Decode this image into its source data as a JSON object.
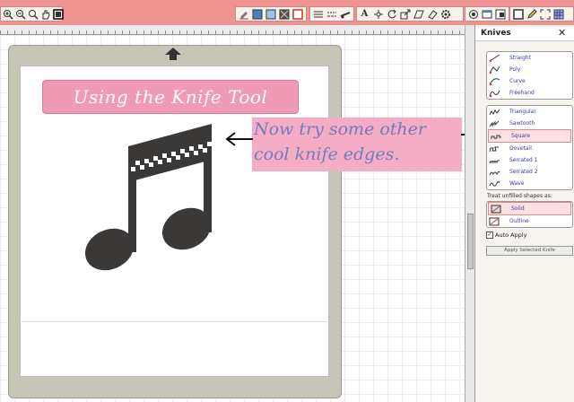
{
  "toolbar": {
    "accent": "#ee9292"
  },
  "canvas": {
    "title_banner": "Using the Knife Tool",
    "note_lines": [
      "Now try some other",
      "cool knife edges."
    ]
  },
  "panel": {
    "title": "Knives",
    "close_label": "✕",
    "group1": [
      {
        "label": "Straight",
        "icon": "straight-knife-icon"
      },
      {
        "label": "Poly",
        "icon": "poly-knife-icon"
      },
      {
        "label": "Curve",
        "icon": "curve-knife-icon"
      },
      {
        "label": "Freehand",
        "icon": "freehand-knife-icon"
      }
    ],
    "group2": [
      {
        "label": "Triangular",
        "icon": "triangular-edge-icon"
      },
      {
        "label": "Sawtooth",
        "icon": "sawtooth-edge-icon"
      },
      {
        "label": "Square",
        "icon": "square-edge-icon",
        "selected": true
      },
      {
        "label": "Dovetail",
        "icon": "dovetail-edge-icon"
      },
      {
        "label": "Serrated 1",
        "icon": "serrated1-edge-icon"
      },
      {
        "label": "Serrated 2",
        "icon": "serrated2-edge-icon"
      },
      {
        "label": "Wave",
        "icon": "wave-edge-icon"
      }
    ],
    "treat_label": "Treat unfilled shapes as:",
    "group3": [
      {
        "label": "Solid",
        "icon": "solid-fill-icon",
        "selected": true
      },
      {
        "label": "Outline",
        "icon": "outline-fill-icon"
      }
    ],
    "auto_apply_label": "Auto Apply",
    "auto_apply_checked": true,
    "apply_button": "Apply Selected Knife"
  }
}
